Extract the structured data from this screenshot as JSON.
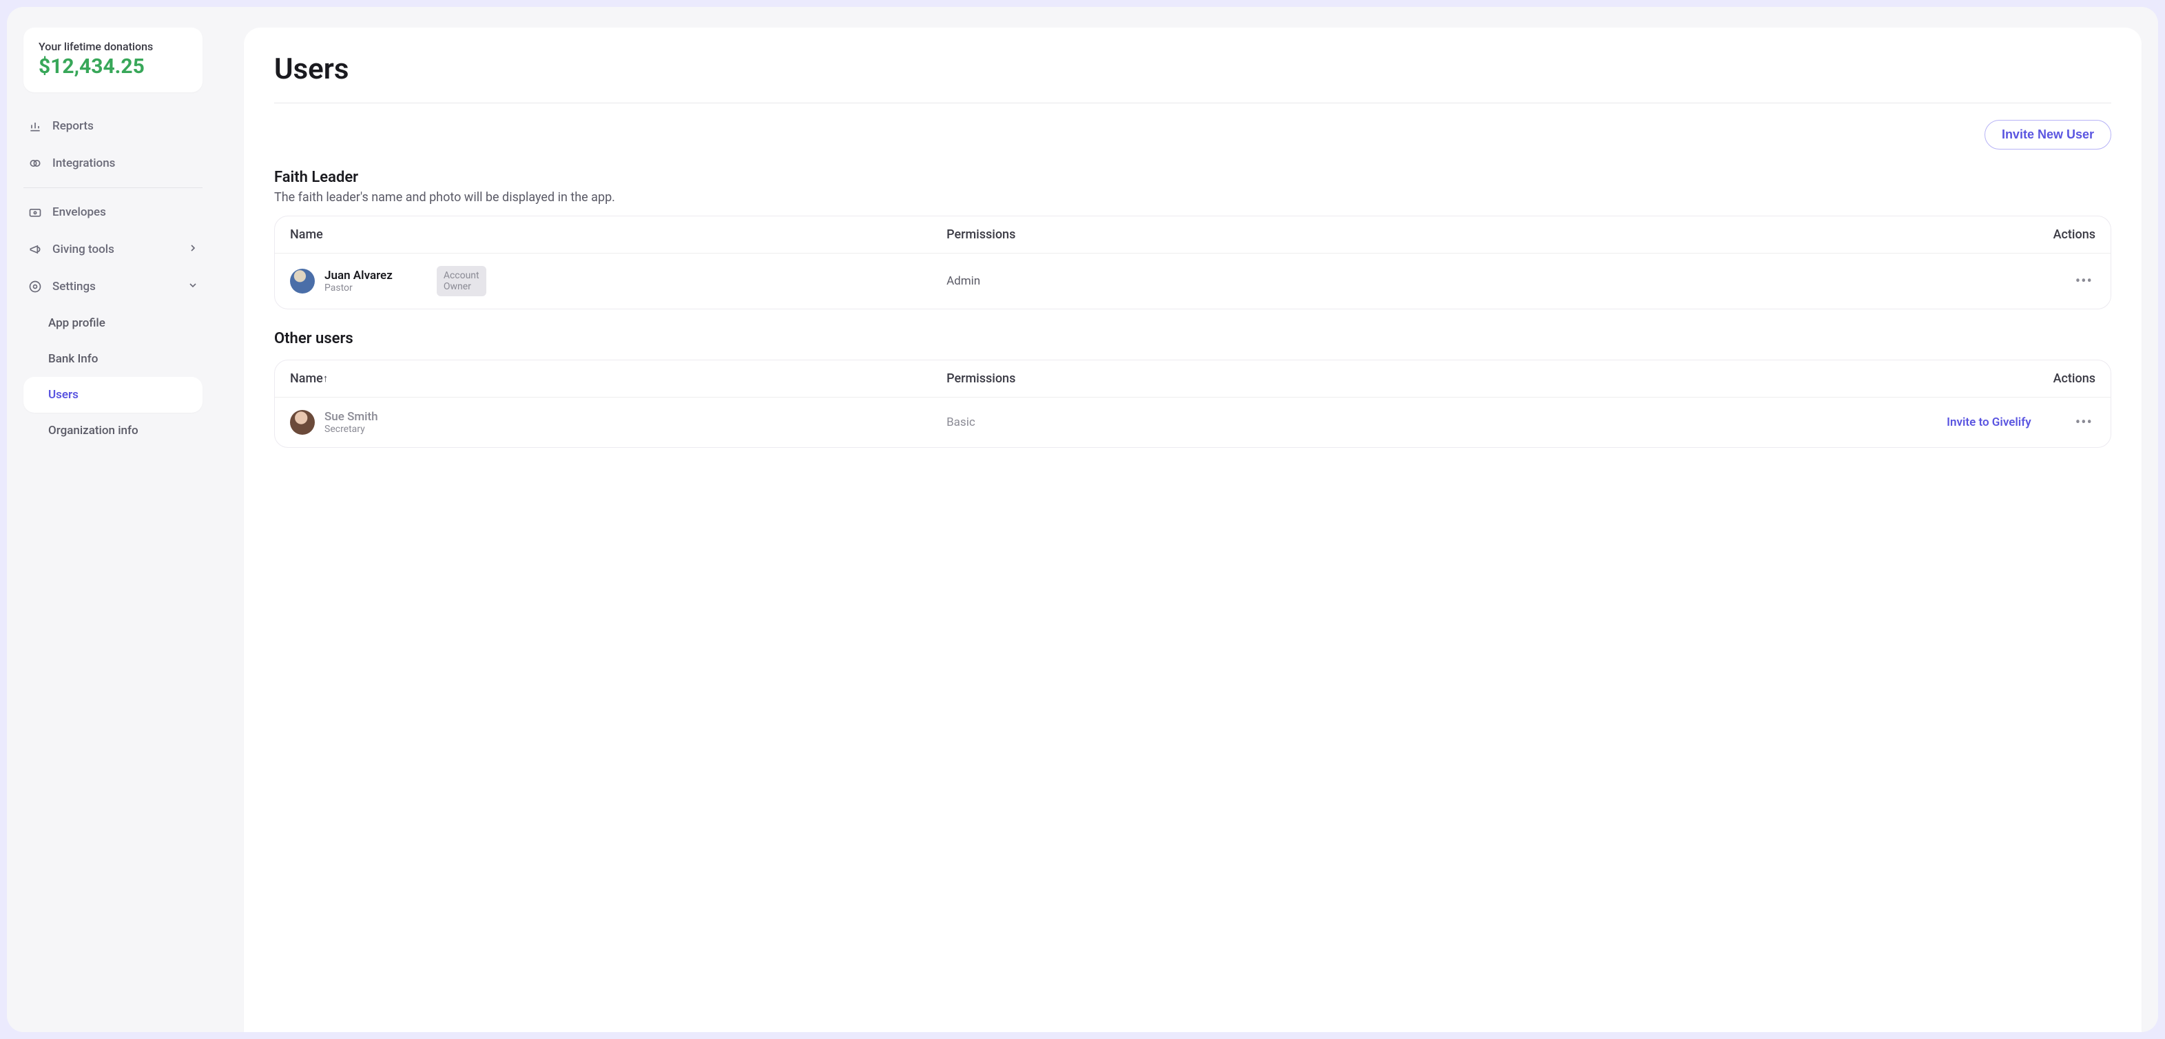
{
  "sidebar": {
    "donations_label": "Your lifetime donations",
    "donations_amount": "$12,434.25",
    "nav": {
      "reports": "Reports",
      "integrations": "Integrations",
      "envelopes": "Envelopes",
      "giving_tools": "Giving tools",
      "settings": "Settings"
    },
    "settings_sub": {
      "app_profile": "App profile",
      "bank_info": "Bank Info",
      "users": "Users",
      "org_info": "Organization info"
    }
  },
  "page": {
    "title": "Users",
    "invite_button": "Invite New User"
  },
  "faith_leader": {
    "heading": "Faith Leader",
    "description": "The faith leader's name and photo will be displayed in the app.",
    "columns": {
      "name": "Name",
      "permissions": "Permissions",
      "actions": "Actions"
    },
    "row": {
      "name": "Juan Alvarez",
      "role": "Pastor",
      "badge_line1": "Account",
      "badge_line2": "Owner",
      "permission": "Admin"
    }
  },
  "other_users": {
    "heading": "Other users",
    "columns": {
      "name": "Name",
      "permissions": "Permissions",
      "actions": "Actions"
    },
    "sort_indicator": "↑",
    "rows": [
      {
        "name": "Sue Smith",
        "role": "Secretary",
        "permission": "Basic",
        "link_action": "Invite to Givelify"
      }
    ]
  }
}
